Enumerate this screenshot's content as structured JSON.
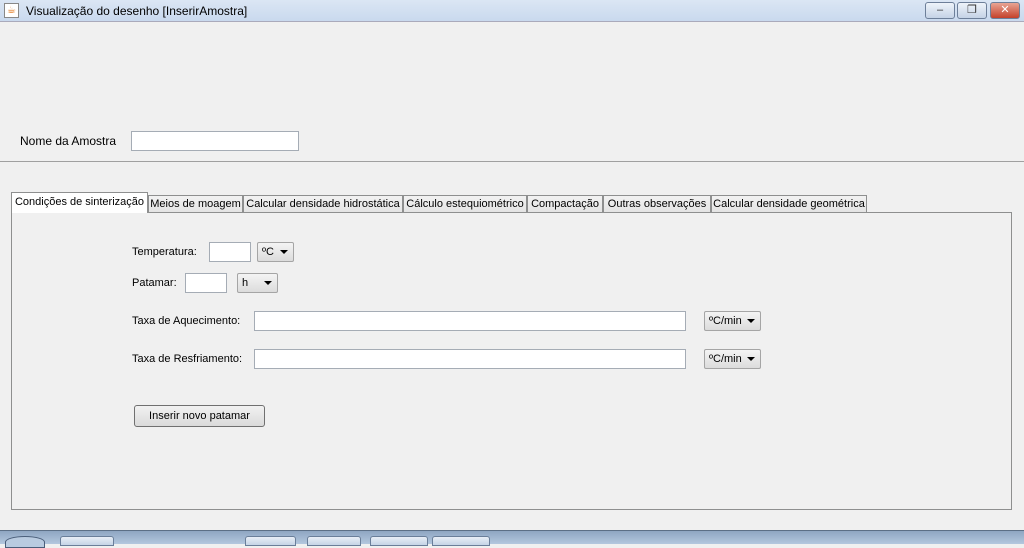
{
  "window": {
    "title": "Visualização do desenho [InserirAmostra]",
    "minimize": "–",
    "restore": "❐",
    "close": "✕"
  },
  "form": {
    "nome_label": "Nome da Amostra",
    "nome_value": ""
  },
  "tabs": [
    {
      "label": "Condições de sinterização",
      "selected": true
    },
    {
      "label": "Meios de moagem"
    },
    {
      "label": "Calcular densidade hidrostática"
    },
    {
      "label": "Cálculo estequiométrico"
    },
    {
      "label": "Compactação"
    },
    {
      "label": "Outras observações"
    },
    {
      "label": "Calcular densidade geométrica"
    }
  ],
  "panel": {
    "temperatura_label": "Temperatura:",
    "temperatura_value": "",
    "temperatura_unit": "ºC",
    "patamar_label": "Patamar:",
    "patamar_value": "",
    "patamar_unit": "h",
    "aquecimento_label": "Taxa de Aquecimento:",
    "aquecimento_value": "",
    "aquecimento_unit": "ºC/min",
    "resfriamento_label": "Taxa de Resfriamento:",
    "resfriamento_value": "",
    "resfriamento_unit": "ºC/min",
    "inserir_button": "Inserir novo patamar"
  }
}
